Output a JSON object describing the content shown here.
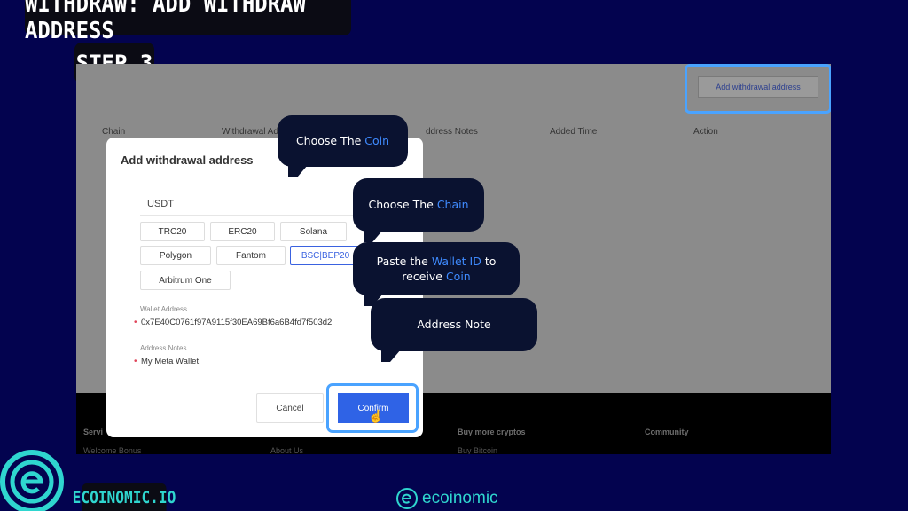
{
  "title": "WITHDRAW: ADD WITHDRAW ADDRESS",
  "step": "STEP 3",
  "page": {
    "add_button": "Add withdrawal address",
    "columns": [
      "Chain",
      "Withdrawal Ad",
      "ddress Notes",
      "Added Time",
      "Action"
    ],
    "footer": {
      "headers": [
        "Servi",
        "Buy more cryptos",
        "Community"
      ],
      "links": [
        "Welcome Bonus",
        "About Us",
        "Buy Bitcoin"
      ]
    }
  },
  "modal": {
    "title": "Add withdrawal address",
    "coin": "USDT",
    "chains": [
      {
        "label": "TRC20"
      },
      {
        "label": "ERC20"
      },
      {
        "label": "Solana"
      },
      {
        "label": "Polygon"
      },
      {
        "label": "Fantom"
      },
      {
        "label": "BSC|BEP20",
        "selected": true
      },
      {
        "label": "Arbitrum One"
      }
    ],
    "wallet_label": "Wallet Address",
    "wallet_value": "0x7E40C0761f97A9115f30EA69Bf6a6B4fd7f503d2",
    "notes_label": "Address Notes",
    "notes_value": "My Meta Wallet",
    "cancel": "Cancel",
    "confirm": "Confirm"
  },
  "callouts": {
    "coin": {
      "a": "Choose The ",
      "b": "Coin"
    },
    "chain": {
      "a": "Choose The ",
      "b": "Chain"
    },
    "wallet": {
      "a": "Paste the ",
      "b": "Wallet ID",
      "c": " to",
      "d": "receive ",
      "e": "Coin"
    },
    "note": "Address Note"
  },
  "brand": "ECOINOMIC.IO",
  "watermark": "ecoinomic",
  "colors": {
    "background": "#03034f",
    "accent": "#2f63e6",
    "highlight": "#4aa3ff",
    "brand": "#2fd6cf"
  }
}
